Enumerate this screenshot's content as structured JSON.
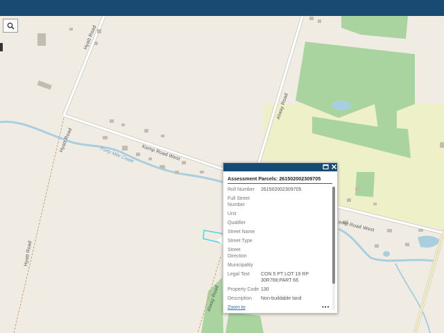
{
  "colors": {
    "header": "#184a72",
    "map_bg": "#f0ece4",
    "forest": "#a9d4a0",
    "field": "#eef0c8",
    "water": "#a8cfe0",
    "parcel": "#4fd4e0"
  },
  "map": {
    "search_icon": "search-icon",
    "roads": {
      "hyatt_top": "Hyatt Road",
      "hyatt_left": "Hyatt Road",
      "hyatt_low": "Hyatt Road",
      "kemp": "Kemp Road West",
      "kemp_east": "Kemp Road West",
      "alway_top": "Alway Road",
      "alway_low": "Alway Road"
    },
    "creek": "Forty Mile Creek"
  },
  "popup": {
    "title": "Assessment Parcels: 261502002309705",
    "maximize_icon": "maximize-icon",
    "close_icon": "close-icon",
    "fields": [
      {
        "label": "Roll Number",
        "value": "261502002309705"
      },
      {
        "label": "Full Street Number",
        "value": ""
      },
      {
        "label": "Unit",
        "value": ""
      },
      {
        "label": "Qualifier",
        "value": ""
      },
      {
        "label": "Street Name",
        "value": ""
      },
      {
        "label": "Street Type",
        "value": ""
      },
      {
        "label": "Street Direction",
        "value": ""
      },
      {
        "label": "Municipality",
        "value": ""
      },
      {
        "label": "Legal Text",
        "value": "CON 5 PT LOT 19 RP 30R768;PART 66"
      },
      {
        "label": "Property Code",
        "value": "130"
      },
      {
        "label": "Description",
        "value": "Non-buildable land"
      }
    ],
    "zoom_link": "Zoom to",
    "more": "•••"
  }
}
